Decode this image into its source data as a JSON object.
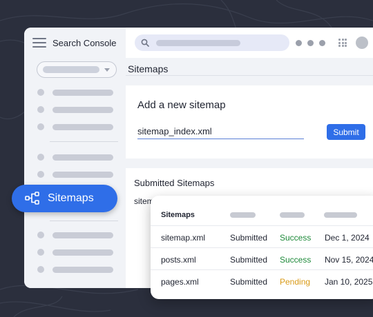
{
  "app": {
    "title": "Search Console"
  },
  "page": {
    "title": "Sitemaps"
  },
  "add_sitemap": {
    "heading": "Add a new sitemap",
    "input_value": "sitemap_index.xml",
    "submit_label": "Submit"
  },
  "submitted": {
    "heading": "Submitted Sitemaps",
    "sub_label": "sitem"
  },
  "sidebar": {
    "active_label": "Sitemaps"
  },
  "table": {
    "header": "Sitemaps",
    "rows": [
      {
        "name": "sitemap.xml",
        "type": "Submitted",
        "status": "Success",
        "date": "Dec 1, 2024"
      },
      {
        "name": "posts.xml",
        "type": "Submitted",
        "status": "Success",
        "date": "Nov 15, 2024"
      },
      {
        "name": "pages.xml",
        "type": "Submitted",
        "status": "Pending",
        "date": "Jan 10, 2025"
      }
    ]
  },
  "colors": {
    "accent": "#2f6ee8",
    "success": "#1e8a3a",
    "pending": "#d99a17",
    "background": "#2b2f3d"
  },
  "icons": [
    "menu-icon",
    "search-icon",
    "more-dots-icon",
    "apps-grid-icon",
    "avatar",
    "sitemap-tree-icon",
    "chevron-down-icon"
  ]
}
